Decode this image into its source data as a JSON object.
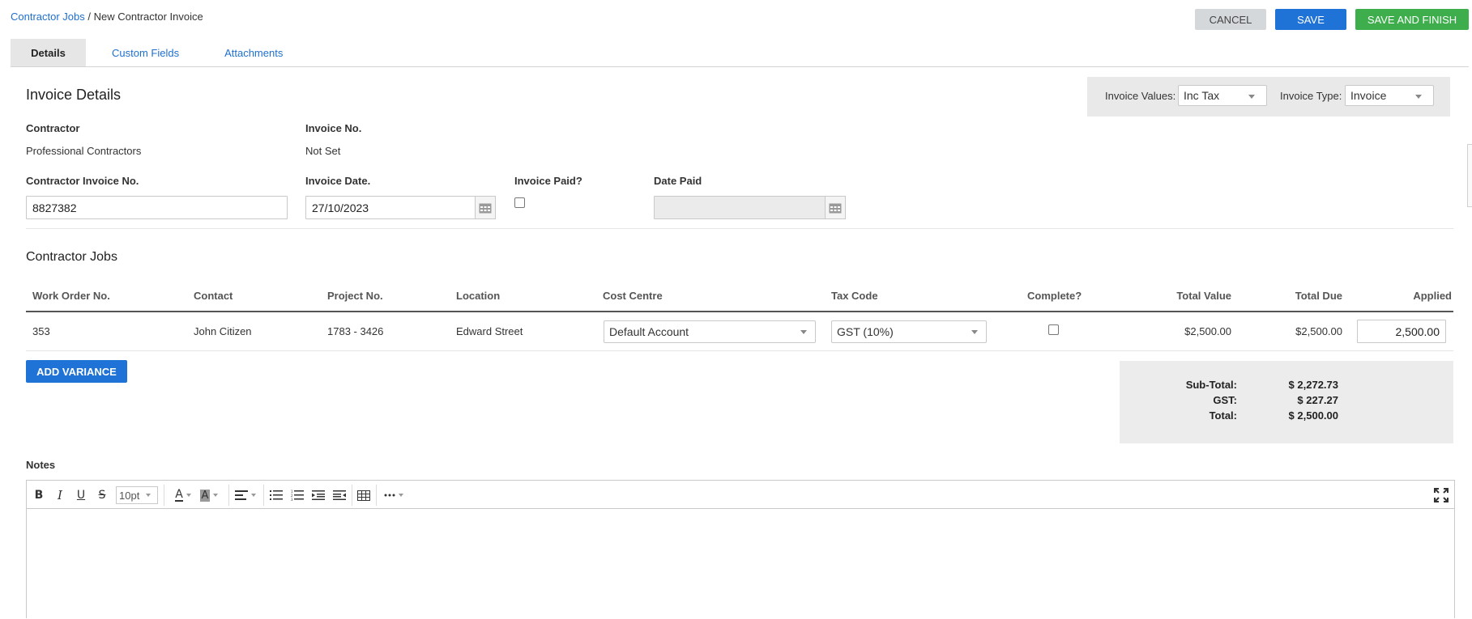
{
  "breadcrumb": {
    "parent": "Contractor Jobs",
    "separator": " / ",
    "current": "New Contractor Invoice"
  },
  "actions": {
    "cancel": "CANCEL",
    "save": "SAVE",
    "save_finish": "SAVE AND FINISH"
  },
  "tabs": [
    {
      "label": "Details",
      "active": true
    },
    {
      "label": "Custom Fields",
      "active": false
    },
    {
      "label": "Attachments",
      "active": false
    }
  ],
  "invoice_details": {
    "title": "Invoice Details",
    "invoice_values_label": "Invoice Values:",
    "invoice_values": "Inc Tax",
    "invoice_type_label": "Invoice Type:",
    "invoice_type": "Invoice",
    "contractor_label": "Contractor",
    "contractor": "Professional Contractors",
    "invoice_no_label": "Invoice No.",
    "invoice_no": "Not Set",
    "contractor_invoice_no_label": "Contractor Invoice No.",
    "contractor_invoice_no": "8827382",
    "invoice_date_label": "Invoice Date.",
    "invoice_date": "27/10/2023",
    "invoice_paid_label": "Invoice Paid?",
    "date_paid_label": "Date Paid",
    "date_paid": ""
  },
  "jobs": {
    "title": "Contractor Jobs",
    "columns": [
      "Work Order No.",
      "Contact",
      "Project No.",
      "Location",
      "Cost Centre",
      "Tax Code",
      "Complete?",
      "Total Value",
      "Total Due",
      "Applied"
    ],
    "rows": [
      {
        "work_order": "353",
        "contact": "John Citizen",
        "project": "1783 - 3426",
        "location": "Edward Street",
        "cost_centre": "Default Account",
        "tax_code": "GST (10%)",
        "complete": false,
        "total_value": "$2,500.00",
        "total_due": "$2,500.00",
        "applied": "2,500.00"
      }
    ],
    "add_variance": "ADD VARIANCE"
  },
  "totals": {
    "subtotal_label": "Sub-Total:",
    "subtotal": "$ 2,272.73",
    "gst_label": "GST:",
    "gst": "$ 227.27",
    "total_label": "Total:",
    "total": "$ 2,500.00"
  },
  "notes": {
    "label": "Notes",
    "font_size": "10pt",
    "content": ""
  },
  "colors": {
    "link": "#1f6fcf",
    "primary": "#1f72d6",
    "success": "#3eae4d",
    "cancel": "#d5d8db"
  }
}
